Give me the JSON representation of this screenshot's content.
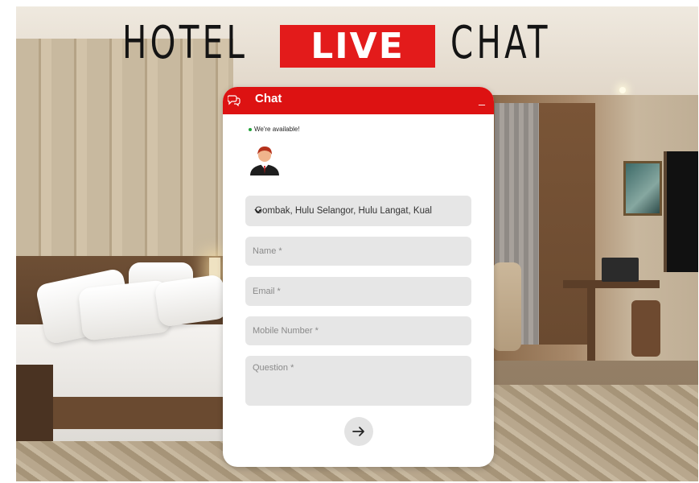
{
  "headline": {
    "word1": "HOTEL",
    "word2": "LIVE",
    "word3": "CHAT"
  },
  "chat": {
    "title": "Chat",
    "minimize_label": "_",
    "status": "We're available!",
    "location_selected": "Gombak, Hulu Selangor, Hulu Langat, Kual",
    "name_placeholder": "Name *",
    "email_placeholder": "Email *",
    "mobile_placeholder": "Mobile Number *",
    "question_placeholder": "Question *"
  },
  "colors": {
    "brand_red": "#dd1212",
    "live_red": "#e31b1b",
    "status_green": "#22a33a"
  },
  "icons": {
    "header": "chat-bubbles-icon",
    "avatar": "agent-avatar-icon",
    "select": "chevron-down-icon",
    "send": "arrow-right-icon"
  }
}
